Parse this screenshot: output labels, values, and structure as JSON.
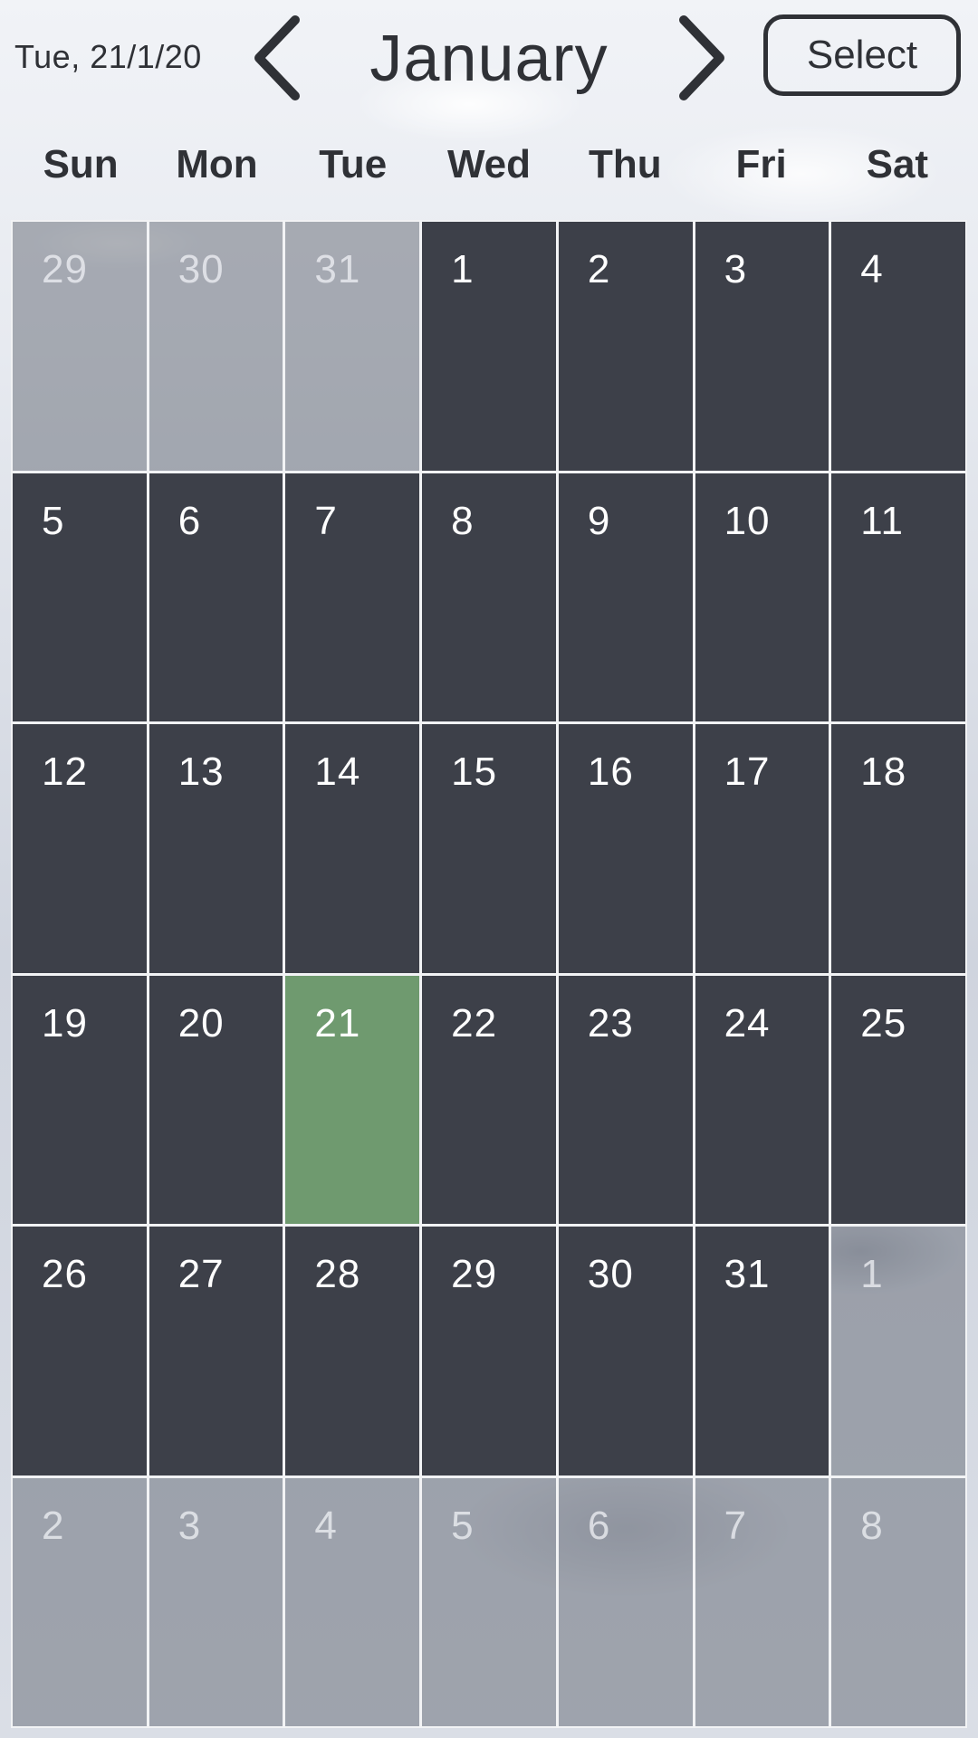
{
  "header": {
    "date_label": "Tue, 21/1/20",
    "month_title": "January",
    "prev_icon": "chevron-left-icon",
    "next_icon": "chevron-right-icon",
    "select_label": "Select"
  },
  "weekdays": [
    "Sun",
    "Mon",
    "Tue",
    "Wed",
    "Thu",
    "Fri",
    "Sat"
  ],
  "colors": {
    "current_month_cell": "#3d4049",
    "other_month_cell": "#6e727e",
    "today_cell": "#6f9a6f",
    "text_dark": "#2f3136",
    "text_light": "#ffffff"
  },
  "calendar": {
    "days": [
      {
        "n": "29",
        "type": "other"
      },
      {
        "n": "30",
        "type": "other"
      },
      {
        "n": "31",
        "type": "other"
      },
      {
        "n": "1",
        "type": "current"
      },
      {
        "n": "2",
        "type": "current"
      },
      {
        "n": "3",
        "type": "current"
      },
      {
        "n": "4",
        "type": "current"
      },
      {
        "n": "5",
        "type": "current"
      },
      {
        "n": "6",
        "type": "current"
      },
      {
        "n": "7",
        "type": "current"
      },
      {
        "n": "8",
        "type": "current"
      },
      {
        "n": "9",
        "type": "current"
      },
      {
        "n": "10",
        "type": "current"
      },
      {
        "n": "11",
        "type": "current"
      },
      {
        "n": "12",
        "type": "current"
      },
      {
        "n": "13",
        "type": "current"
      },
      {
        "n": "14",
        "type": "current"
      },
      {
        "n": "15",
        "type": "current"
      },
      {
        "n": "16",
        "type": "current"
      },
      {
        "n": "17",
        "type": "current"
      },
      {
        "n": "18",
        "type": "current"
      },
      {
        "n": "19",
        "type": "current"
      },
      {
        "n": "20",
        "type": "current"
      },
      {
        "n": "21",
        "type": "today"
      },
      {
        "n": "22",
        "type": "current"
      },
      {
        "n": "23",
        "type": "current"
      },
      {
        "n": "24",
        "type": "current"
      },
      {
        "n": "25",
        "type": "current"
      },
      {
        "n": "26",
        "type": "current"
      },
      {
        "n": "27",
        "type": "current"
      },
      {
        "n": "28",
        "type": "current"
      },
      {
        "n": "29",
        "type": "current"
      },
      {
        "n": "30",
        "type": "current"
      },
      {
        "n": "31",
        "type": "current"
      },
      {
        "n": "1",
        "type": "other"
      },
      {
        "n": "2",
        "type": "other"
      },
      {
        "n": "3",
        "type": "other"
      },
      {
        "n": "4",
        "type": "other"
      },
      {
        "n": "5",
        "type": "other"
      },
      {
        "n": "6",
        "type": "other"
      },
      {
        "n": "7",
        "type": "other"
      },
      {
        "n": "8",
        "type": "other"
      }
    ]
  }
}
